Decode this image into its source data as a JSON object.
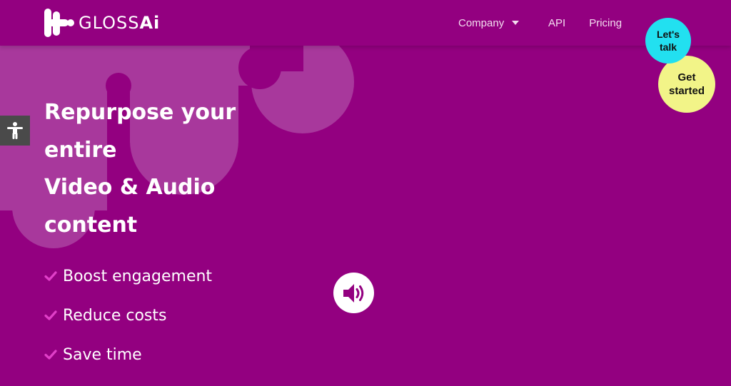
{
  "brand": {
    "logo_text_light": "GLOSS",
    "logo_text_bold": "Ai",
    "logo_icon": "glossai-logo-icon"
  },
  "nav": {
    "items": [
      {
        "label": "Company",
        "has_dropdown": true
      },
      {
        "label": "API",
        "has_dropdown": false
      },
      {
        "label": "Pricing",
        "has_dropdown": false
      }
    ]
  },
  "cta": {
    "talk_label": "Let's talk",
    "start_label": "Get started"
  },
  "hero": {
    "headline_lines": [
      "Repurpose your",
      "entire",
      "Video & Audio",
      "content"
    ],
    "features": [
      "Boost engagement",
      "Reduce costs",
      "Save time"
    ]
  },
  "icons": {
    "accessibility": "accessibility-icon",
    "check": "check-icon",
    "sound": "speaker-icon",
    "dropdown": "chevron-down-icon"
  },
  "colors": {
    "background": "#930080",
    "background_shape": "#a8389c",
    "talk_button": "#22e0f0",
    "start_button": "#f2f488",
    "check": "#e040c8",
    "accessibility_button": "#4a4a4a"
  }
}
